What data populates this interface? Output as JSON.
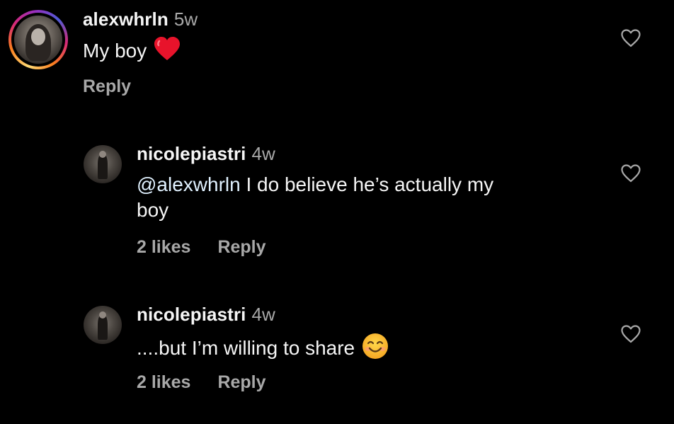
{
  "comments": [
    {
      "username": "alexwhrln",
      "time": "5w",
      "text": "My boy",
      "emoji": "red-heart",
      "reply_label": "Reply"
    },
    {
      "username": "nicolepiastri",
      "time": "4w",
      "mention": "@alexwhrln",
      "text_line1": " I do believe he’s actually my",
      "text_line2": "boy",
      "likes": "2 likes",
      "reply_label": "Reply"
    },
    {
      "username": "nicolepiastri",
      "time": "4w",
      "text": "....but I’m willing to share",
      "emoji": "smiling-face",
      "likes": "2 likes",
      "reply_label": "Reply"
    }
  ],
  "colors": {
    "background": "#000000",
    "primary_text": "#f5f5f5",
    "secondary_text": "#a8a8a8",
    "mention": "#e0f1ff"
  },
  "icons": {
    "like": "heart-outline-icon"
  }
}
